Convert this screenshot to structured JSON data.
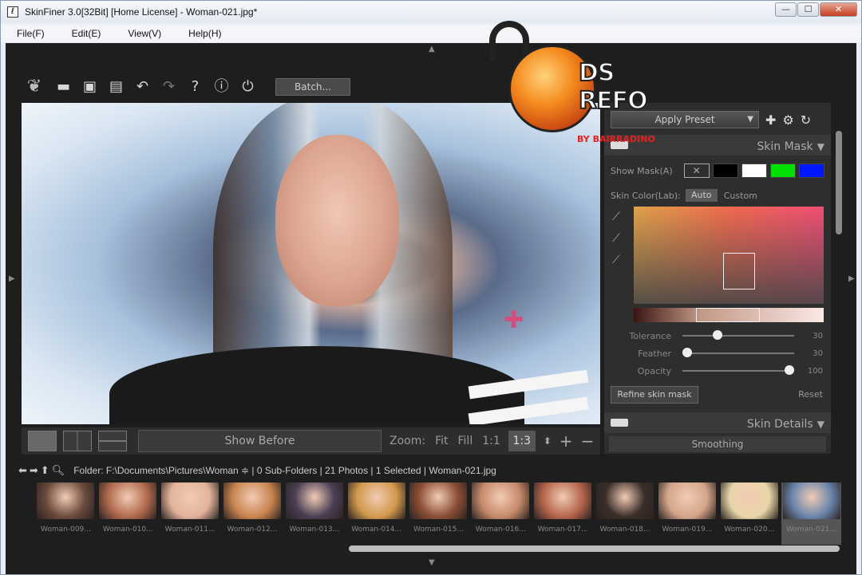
{
  "window": {
    "title": "SkinFiner 3.0[32Bit] [Home License] - Woman-021.jpg*",
    "controls": {
      "minimize": "—",
      "maximize": "☐",
      "close": "✕"
    }
  },
  "menu": [
    "File(F)",
    "Edit(E)",
    "View(V)",
    "Help(H)"
  ],
  "toolbar": {
    "icons": [
      "leaf-icon",
      "open-folder-icon",
      "save-icon",
      "save-as-icon",
      "undo-icon",
      "redo-icon",
      "help-icon",
      "info-icon",
      "plugin-icon"
    ],
    "batch_label": "Batch..."
  },
  "viewbar": {
    "show_before_label": "Show Before",
    "zoom_label": "Zoom:",
    "zoom_options": [
      "Fit",
      "Fill",
      "1:1"
    ],
    "zoom_value": "1:3"
  },
  "panel": {
    "apply_preset_label": "Apply Preset",
    "skin_mask": {
      "title": "Skin Mask",
      "show_mask_label": "Show Mask(A)",
      "mask_colors": [
        "#000000",
        "#ffffff",
        "#00e000",
        "#0018ff"
      ],
      "skin_color_label": "Skin Color(Lab):",
      "auto_label": "Auto",
      "custom_label": "Custom",
      "sliders": [
        {
          "label": "Tolerance",
          "value": "30",
          "fraction": 0.3
        },
        {
          "label": "Feather",
          "value": "30",
          "fraction": 0.0
        },
        {
          "label": "Opacity",
          "value": "100",
          "fraction": 1.0
        }
      ],
      "refine_label": "Refine skin mask",
      "reset_label": "Reset"
    },
    "skin_details": {
      "title": "Skin Details",
      "smoothing_label": "Smoothing"
    }
  },
  "folder_bar": {
    "text": "Folder: F:\\Documents\\Pictures\\Woman ≑ | 0 Sub-Folders | 21 Photos | 1 Selected | Woman-021.jpg"
  },
  "thumbnails": [
    {
      "name": "Woman-009...",
      "color": "#6b4a3d"
    },
    {
      "name": "Woman-010...",
      "color": "#b06a4e"
    },
    {
      "name": "Woman-011...",
      "color": "#e2b39a"
    },
    {
      "name": "Woman-012...",
      "color": "#c9844f"
    },
    {
      "name": "Woman-013...",
      "color": "#4a3f55"
    },
    {
      "name": "Woman-014...",
      "color": "#d29a4d"
    },
    {
      "name": "Woman-015...",
      "color": "#8a4e35"
    },
    {
      "name": "Woman-016...",
      "color": "#c58a6a"
    },
    {
      "name": "Woman-017...",
      "color": "#b5654c"
    },
    {
      "name": "Woman-018...",
      "color": "#3a2e2a"
    },
    {
      "name": "Woman-019...",
      "color": "#d4a58a"
    },
    {
      "name": "Woman-020...",
      "color": "#e8d6a8"
    },
    {
      "name": "Woman-021...",
      "color": "#6a86ab"
    }
  ],
  "watermark": {
    "text": "DS REFO",
    "sub": "BY BAIRRADINO"
  }
}
